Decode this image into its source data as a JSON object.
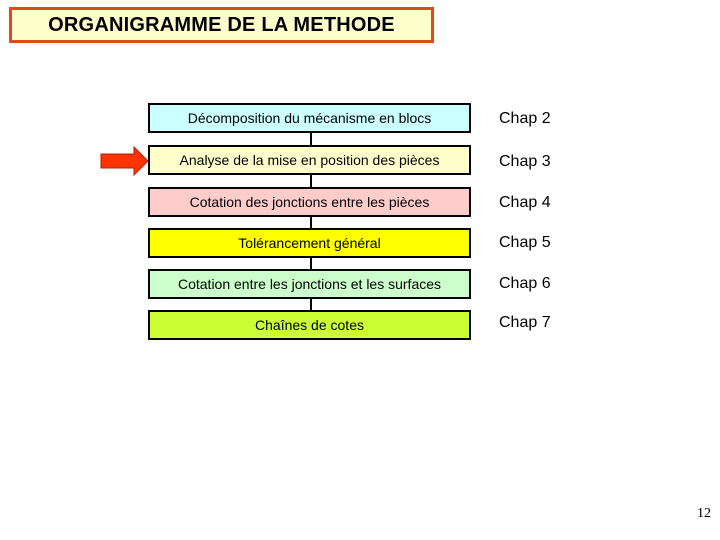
{
  "title": "ORGANIGRAMME DE LA METHODE",
  "steps": [
    {
      "label": "Décomposition du mécanisme en blocs",
      "chapter": "Chap 2",
      "color": "#ccffff"
    },
    {
      "label": "Analyse de la mise en position des pièces",
      "chapter": "Chap 3",
      "color": "#ffffcc"
    },
    {
      "label": "Cotation des jonctions entre les pièces",
      "chapter": "Chap 4",
      "color": "#ffcccc"
    },
    {
      "label": "Tolérancement général",
      "chapter": "Chap 5",
      "color": "#ffff00"
    },
    {
      "label": "Cotation entre les jonctions et les surfaces",
      "chapter": "Chap 6",
      "color": "#ccffcc"
    },
    {
      "label": "Chaînes de cotes",
      "chapter": "Chap 7",
      "color": "#ccff33"
    }
  ],
  "current_step_indicator": {
    "step_index": 1,
    "icon": "arrow-right-icon",
    "color": "#ff3300"
  },
  "page_number": "12"
}
